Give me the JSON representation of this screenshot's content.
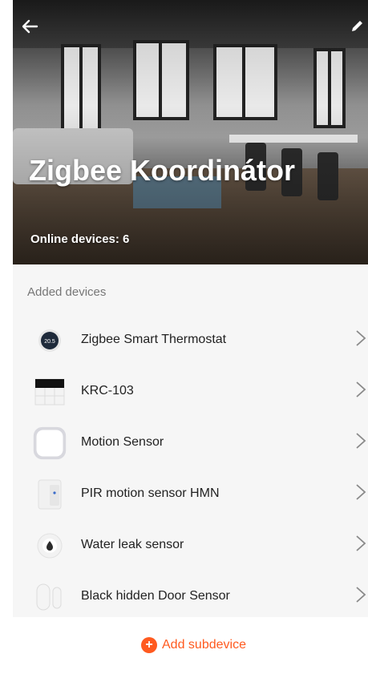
{
  "header": {
    "title": "Zigbee Koordinátor",
    "online_label": "Online devices: 6"
  },
  "section_title": "Added devices",
  "devices": [
    {
      "label": "Zigbee Smart Thermostat",
      "icon": "thermostat-icon"
    },
    {
      "label": "KRC-103",
      "icon": "switch-panel-icon"
    },
    {
      "label": "Motion Sensor",
      "icon": "motion-sensor-icon"
    },
    {
      "label": "PIR motion sensor HMN",
      "icon": "pir-sensor-icon"
    },
    {
      "label": "Water leak sensor",
      "icon": "water-drop-icon"
    },
    {
      "label": "Black hidden Door Sensor",
      "icon": "door-sensor-icon"
    }
  ],
  "add_button": {
    "label": "Add subdevice"
  },
  "colors": {
    "accent": "#ff5a1f",
    "background": "#f6f6f6"
  }
}
